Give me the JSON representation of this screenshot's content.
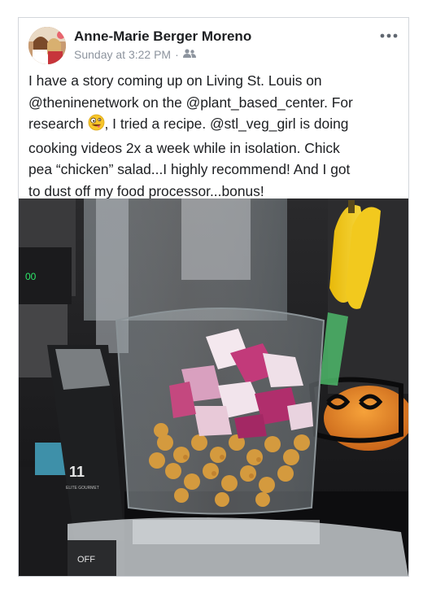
{
  "post": {
    "author": "Anne-Marie Berger Moreno",
    "timestamp": "Sunday at 3:22 PM",
    "separator": "·",
    "audience_icon": "friends-icon",
    "more_icon": "ellipsis-icon",
    "text_lines": [
      "I have a story coming up on Living St. Louis on",
      "@theninenetwork  on the @plant_based_center.  For",
      ", I tried a recipe. @stl_veg_girl is doing",
      "cooking videos 2x a week while in isolation.   Chick",
      "pea “chicken” salad...I highly recommend! And I got",
      "to dust off my food processor...bonus!"
    ],
    "text_line3_prefix": "research ",
    "emoji_icon": "zany-face-emoji-icon",
    "photo": {
      "icon": "food-processor-photo",
      "processor_bowl_label": "11",
      "processor_brand_label": "ELITE GOURMET",
      "processor_button_label": "OFF"
    }
  },
  "colors": {
    "author": "#1c1e21",
    "meta": "#8d949e",
    "border": "#d3d6db"
  }
}
